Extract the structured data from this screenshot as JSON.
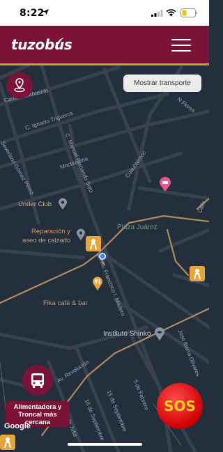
{
  "status_bar": {
    "time": "8:22"
  },
  "header": {
    "logo_text": "tuzobus"
  },
  "controls": {
    "show_transport_label": "Mostrar transporte",
    "feeder_label": "Alimentadora y Troncal más cercana",
    "sos_label": "SOS",
    "google_label": "Google"
  },
  "map": {
    "streets": [
      "Carretera Abasolo",
      "N Flores",
      "C. Ignacio Trigueros",
      "Severiano Gómez Pérez",
      "C. Manuel Fernando Soto",
      "Moctezuma",
      "Cuauhtémoc",
      "Calle",
      "Av. Francisco I. Madero",
      "José Ibarra Olivares",
      "Av. Revolución",
      "5 de Febrero",
      "15 de Septiembre",
      "16 de Septiembre",
      "28 de Julio"
    ],
    "pois": {
      "under_club": "Under Club",
      "reparacion_line1": "Reparación y",
      "reparacion_line2": "aseo de calzado",
      "plaza_juarez": "Plaza Juárez",
      "fika": "Fika café & bar",
      "instituto": "Instituto Shinko"
    }
  },
  "colors": {
    "brand": "#7b1339",
    "accent": "#c9a227",
    "map_bg": "#242f3e",
    "stop": "#e8a43a",
    "sos": "#d00000"
  },
  "icons": [
    "location-arrow-icon",
    "signal-icon",
    "wifi-icon",
    "battery-icon",
    "menu-icon",
    "location-pin-icon",
    "bus-icon",
    "user-location-icon",
    "bus-stop-icon",
    "poi-pin-icon",
    "hotel-icon",
    "restaurant-icon"
  ]
}
